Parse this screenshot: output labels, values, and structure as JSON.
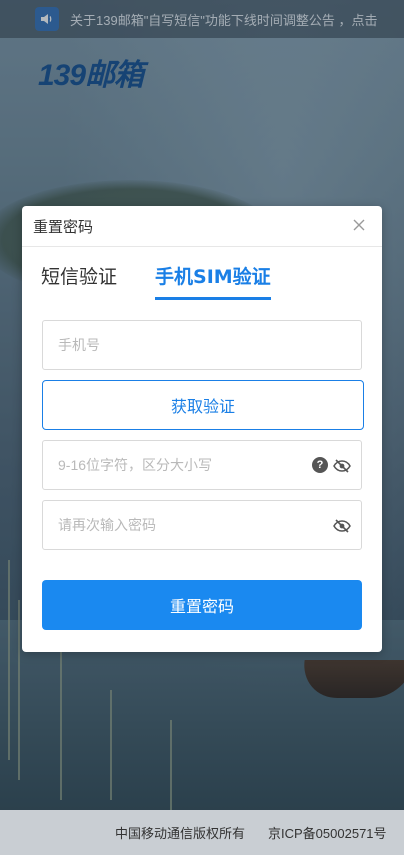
{
  "notice": {
    "icon": "speaker-icon",
    "text": "关于139邮箱\"自写短信\"功能下线时间调整公告 ，点击"
  },
  "brand": {
    "logo_text": "139邮箱",
    "color": "#0d4a8e"
  },
  "modal": {
    "title": "重置密码",
    "close_icon": "close-icon",
    "tabs": [
      {
        "label": "短信验证",
        "active": false
      },
      {
        "label": "手机SIM验证",
        "active": true
      }
    ],
    "phone_placeholder": "手机号",
    "get_code_label": "获取验证",
    "password_placeholder": "9-16位字符，区分大小写",
    "confirm_placeholder": "请再次输入密码",
    "help_icon": "question-icon",
    "eye_icon": "eye-hidden-icon",
    "submit_label": "重置密码",
    "accent_color": "#1a89f0"
  },
  "footer": {
    "copyright": "中国移动通信版权所有",
    "icp": "京ICP备05002571号"
  }
}
